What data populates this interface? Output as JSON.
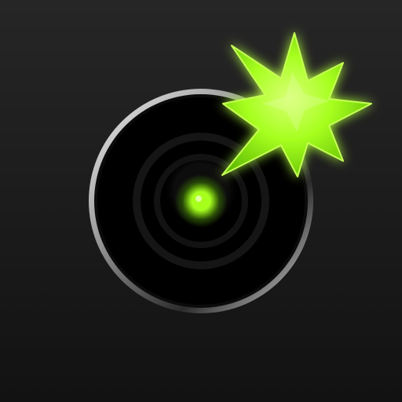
{
  "icon": {
    "kind": "app-icon",
    "subject": "lens-with-burst",
    "elements": [
      "background",
      "lens-ring",
      "lens-center-dot",
      "burst-star"
    ],
    "colors": {
      "background_top": "#262626",
      "background_bottom": "#121212",
      "lens_inner": "#000000",
      "ring_light": "#f2f2f2",
      "ring_dark": "#2b2b2b",
      "inner_ring": "#151515",
      "accent": "#a7ff1f",
      "accent_core": "#d8ff73",
      "accent_dark": "#5bb800"
    }
  }
}
